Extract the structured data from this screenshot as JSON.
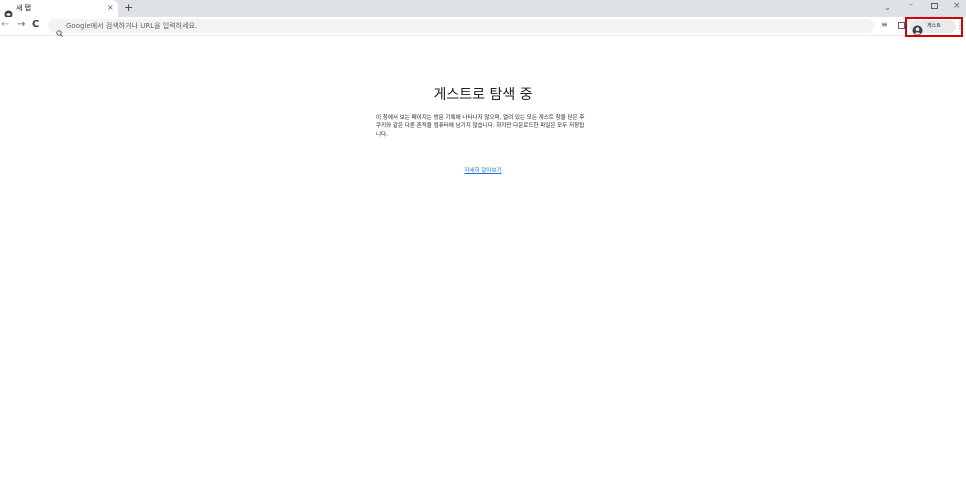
{
  "tab": {
    "title": "새 탭",
    "close_glyph": "×",
    "favicon_icon": "incognito-globe-icon"
  },
  "tabstrip": {
    "newtab_glyph": "+",
    "chevron_glyph": "⌄",
    "minimize_glyph": "–",
    "close_glyph": "×"
  },
  "toolbar": {
    "back_glyph": "←",
    "forward_glyph": "→",
    "reload_glyph": "C",
    "omnibox_placeholder": "Google에서 검색하거나 URL을 입력하세요.",
    "readinglist_glyph": "≡",
    "menu_glyph": "⋮"
  },
  "profile": {
    "label": "게스트"
  },
  "main": {
    "title": "게스트로 탐색 중",
    "description": "이 창에서 보는 페이지는 방문 기록에 나타나지 않으며, 열려 있는 모든 게스트 창을 닫은 후 쿠키와 같은 다른 흔적을 컴퓨터에 남기지 않습니다. 하지만 다운로드한 파일은 모두 저장됩니다.",
    "learn_more": "자세히 알아보기"
  },
  "colors": {
    "tabstrip_bg": "#dee1e6",
    "omnibox_bg": "#f1f3f4",
    "highlight_red": "#d70000",
    "link_blue": "#1a73e8"
  }
}
